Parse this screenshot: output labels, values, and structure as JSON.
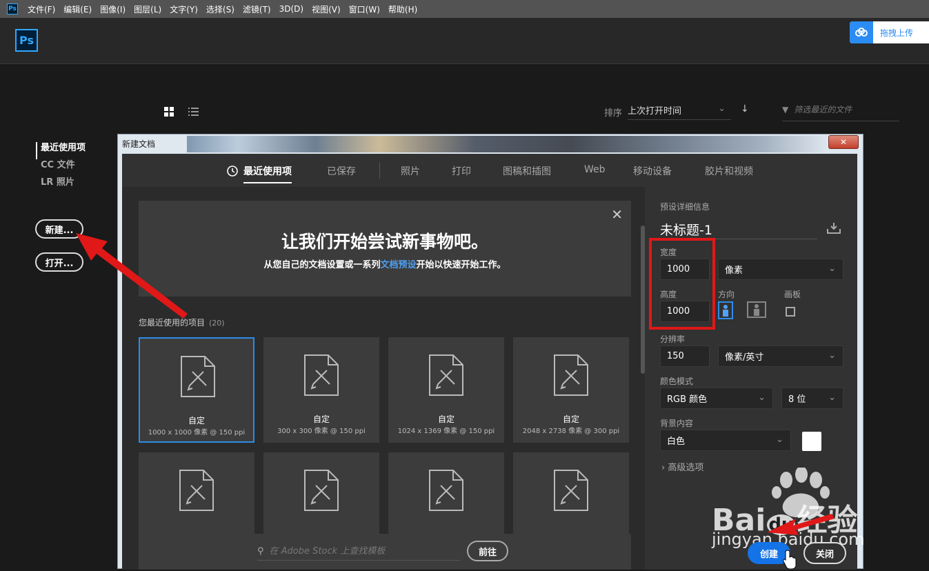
{
  "menubar": {
    "app_icon_label": "Ps",
    "items": [
      "文件(F)",
      "编辑(E)",
      "图像(I)",
      "图层(L)",
      "文字(Y)",
      "选择(S)",
      "滤镜(T)",
      "3D(D)",
      "视图(V)",
      "窗口(W)",
      "帮助(H)"
    ]
  },
  "home": {
    "logo_label": "Ps",
    "upload_label": "拖拽上传",
    "sort_label": "排序",
    "sort_value": "上次打开时间",
    "filter_placeholder": "筛选最近的文件",
    "nav": [
      "最近使用项",
      "CC 文件",
      "LR 照片"
    ],
    "new_button": "新建...",
    "open_button": "打开..."
  },
  "dialog": {
    "title": "新建文档",
    "tabs": [
      "最近使用项",
      "已保存",
      "照片",
      "打印",
      "图稿和插图",
      "Web",
      "移动设备",
      "胶片和视频"
    ],
    "hero_title": "让我们开始尝试新事物吧。",
    "hero_sub_pre": "从您自己的文档设置或一系列",
    "hero_sub_link": "文档预设",
    "hero_sub_post": "开始以快速开始工作。",
    "recent_heading": "您最近使用的项目",
    "recent_count": "(20)",
    "cards": [
      {
        "name": "自定",
        "dims": "1000 x 1000 像素 @ 150 ppi"
      },
      {
        "name": "自定",
        "dims": "300 x 300 像素 @ 150 ppi"
      },
      {
        "name": "自定",
        "dims": "1024 x 1369 像素 @ 150 ppi"
      },
      {
        "name": "自定",
        "dims": "2048 x 2738 像素 @ 300 ppi"
      }
    ],
    "stock_placeholder": "在 Adobe Stock 上查找模板",
    "goto_button": "前往",
    "details": {
      "section_label": "预设详细信息",
      "doc_title": "未标题-1",
      "width_label": "宽度",
      "width_value": "1000",
      "width_unit": "像素",
      "height_label": "高度",
      "height_value": "1000",
      "orientation_label": "方向",
      "artboard_label": "画板",
      "resolution_label": "分辨率",
      "resolution_value": "150",
      "resolution_unit": "像素/英寸",
      "color_mode_label": "颜色模式",
      "color_mode_value": "RGB 颜色",
      "bit_depth_value": "8 位",
      "background_label": "背景内容",
      "background_value": "白色",
      "advanced_label": "高级选项",
      "create_button": "创建",
      "close_button": "关闭"
    }
  },
  "watermark": {
    "brand": "Bai",
    "brand_mid": "du",
    "brand_cn": "经验",
    "url": "jingyan.baidu.com"
  },
  "colors": {
    "ps_blue": "#31a8ff",
    "accent": "#1473e6",
    "annotation_red": "#e01818"
  }
}
